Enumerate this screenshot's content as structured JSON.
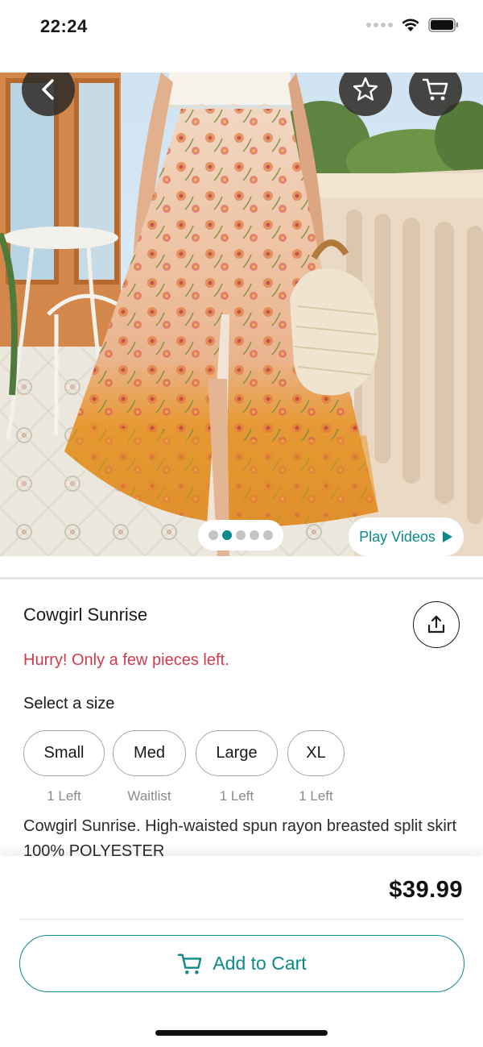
{
  "status_bar": {
    "time": "22:24"
  },
  "hero": {
    "icons": {
      "back": "chevron-left-icon",
      "favorite": "star-icon",
      "cart": "cart-icon"
    },
    "pager": {
      "total": 5,
      "active": 1
    },
    "play_videos_label": "Play Videos"
  },
  "product": {
    "title": "Cowgirl Sunrise",
    "stock_warning": "Hurry! Only a few pieces left.",
    "select_size_label": "Select a size",
    "sizes": [
      {
        "label": "Small",
        "note": "1 Left"
      },
      {
        "label": "Med",
        "note": "Waitlist"
      },
      {
        "label": "Large",
        "note": "1 Left"
      },
      {
        "label": "XL",
        "note": "1 Left"
      }
    ],
    "description": "Cowgirl Sunrise. High-waisted spun rayon breasted split skirt 100% POLYESTER"
  },
  "footer": {
    "price": "$39.99",
    "add_to_cart_label": "Add to Cart"
  },
  "colors": {
    "accent": "#0d8a8a",
    "warning": "#d03a4c",
    "overlay_button": "#302d2a"
  }
}
